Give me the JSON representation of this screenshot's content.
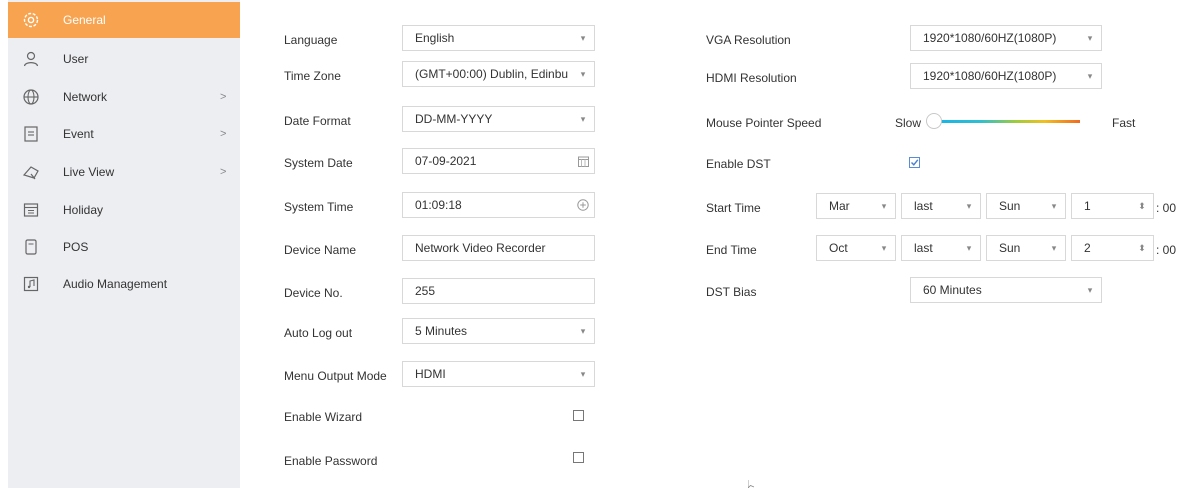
{
  "sidebar": {
    "items": [
      {
        "label": "General",
        "icon": "gear-icon",
        "active": true
      },
      {
        "label": "User",
        "icon": "user-icon"
      },
      {
        "label": "Network",
        "icon": "globe-icon",
        "chevron": ">"
      },
      {
        "label": "Event",
        "icon": "event-list-icon",
        "chevron": ">"
      },
      {
        "label": "Live View",
        "icon": "live-view-icon",
        "chevron": ">"
      },
      {
        "label": "Holiday",
        "icon": "calendar-icon"
      },
      {
        "label": "POS",
        "icon": "pos-icon"
      },
      {
        "label": "Audio Management",
        "icon": "audio-icon"
      }
    ],
    "accent_color": "#f7a34f"
  },
  "left": {
    "language": {
      "label": "Language",
      "value": "English"
    },
    "time_zone": {
      "label": "Time Zone",
      "value": "(GMT+00:00) Dublin, Edinbu"
    },
    "date_format": {
      "label": "Date Format",
      "value": "DD-MM-YYYY"
    },
    "system_date": {
      "label": "System Date",
      "value": "07-09-2021"
    },
    "system_time": {
      "label": "System Time",
      "value": "01:09:18"
    },
    "device_name": {
      "label": "Device Name",
      "value": "Network Video Recorder"
    },
    "device_no": {
      "label": "Device No.",
      "value": "255"
    },
    "auto_logout": {
      "label": "Auto Log out",
      "value": "5 Minutes"
    },
    "menu_output_mode": {
      "label": "Menu Output Mode",
      "value": "HDMI"
    },
    "enable_wizard": {
      "label": "Enable Wizard",
      "checked": false
    },
    "enable_password": {
      "label": "Enable Password",
      "checked": false
    }
  },
  "right": {
    "vga_resolution": {
      "label": "VGA Resolution",
      "value": "1920*1080/60HZ(1080P)"
    },
    "hdmi_resolution": {
      "label": "HDMI Resolution",
      "value": "1920*1080/60HZ(1080P)"
    },
    "mouse_speed": {
      "label": "Mouse Pointer Speed",
      "slow": "Slow",
      "fast": "Fast",
      "level": 0.0
    },
    "enable_dst": {
      "label": "Enable DST",
      "checked": true
    },
    "start_time": {
      "label": "Start Time",
      "month": "Mar",
      "week": "last",
      "day": "Sun",
      "hour": "1",
      "suffix": ": 00"
    },
    "end_time": {
      "label": "End Time",
      "month": "Oct",
      "week": "last",
      "day": "Sun",
      "hour": "2",
      "suffix": ": 00"
    },
    "dst_bias": {
      "label": "DST Bias",
      "value": "60 Minutes"
    }
  }
}
